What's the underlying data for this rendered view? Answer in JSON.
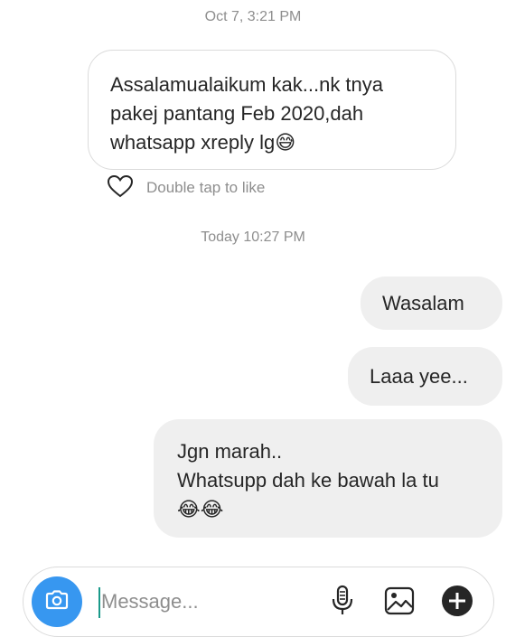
{
  "thread": {
    "timestamps": [
      "Oct 7, 3:21 PM",
      "Today 10:27 PM"
    ],
    "incoming": {
      "text": "Assalamualaikum kak...nk tnya\npakej pantang Feb 2020,dah\nwhatsapp xreply lg",
      "emoji": "😅",
      "like_hint": "Double tap to like"
    },
    "outgoing": [
      {
        "text": "Wasalam"
      },
      {
        "text": "Laaa yee..."
      },
      {
        "text": "Jgn marah..\nWhatsupp dah ke bawah la tu",
        "emoji": "😂😂"
      }
    ]
  },
  "composer": {
    "placeholder": "Message...",
    "icons": [
      "camera-icon",
      "microphone-icon",
      "gallery-icon",
      "add-icon"
    ]
  },
  "colors": {
    "accent": "#3797f0",
    "bubble_out": "#efefef",
    "border": "#dbdbdb",
    "muted_text": "#8e8e8e"
  }
}
